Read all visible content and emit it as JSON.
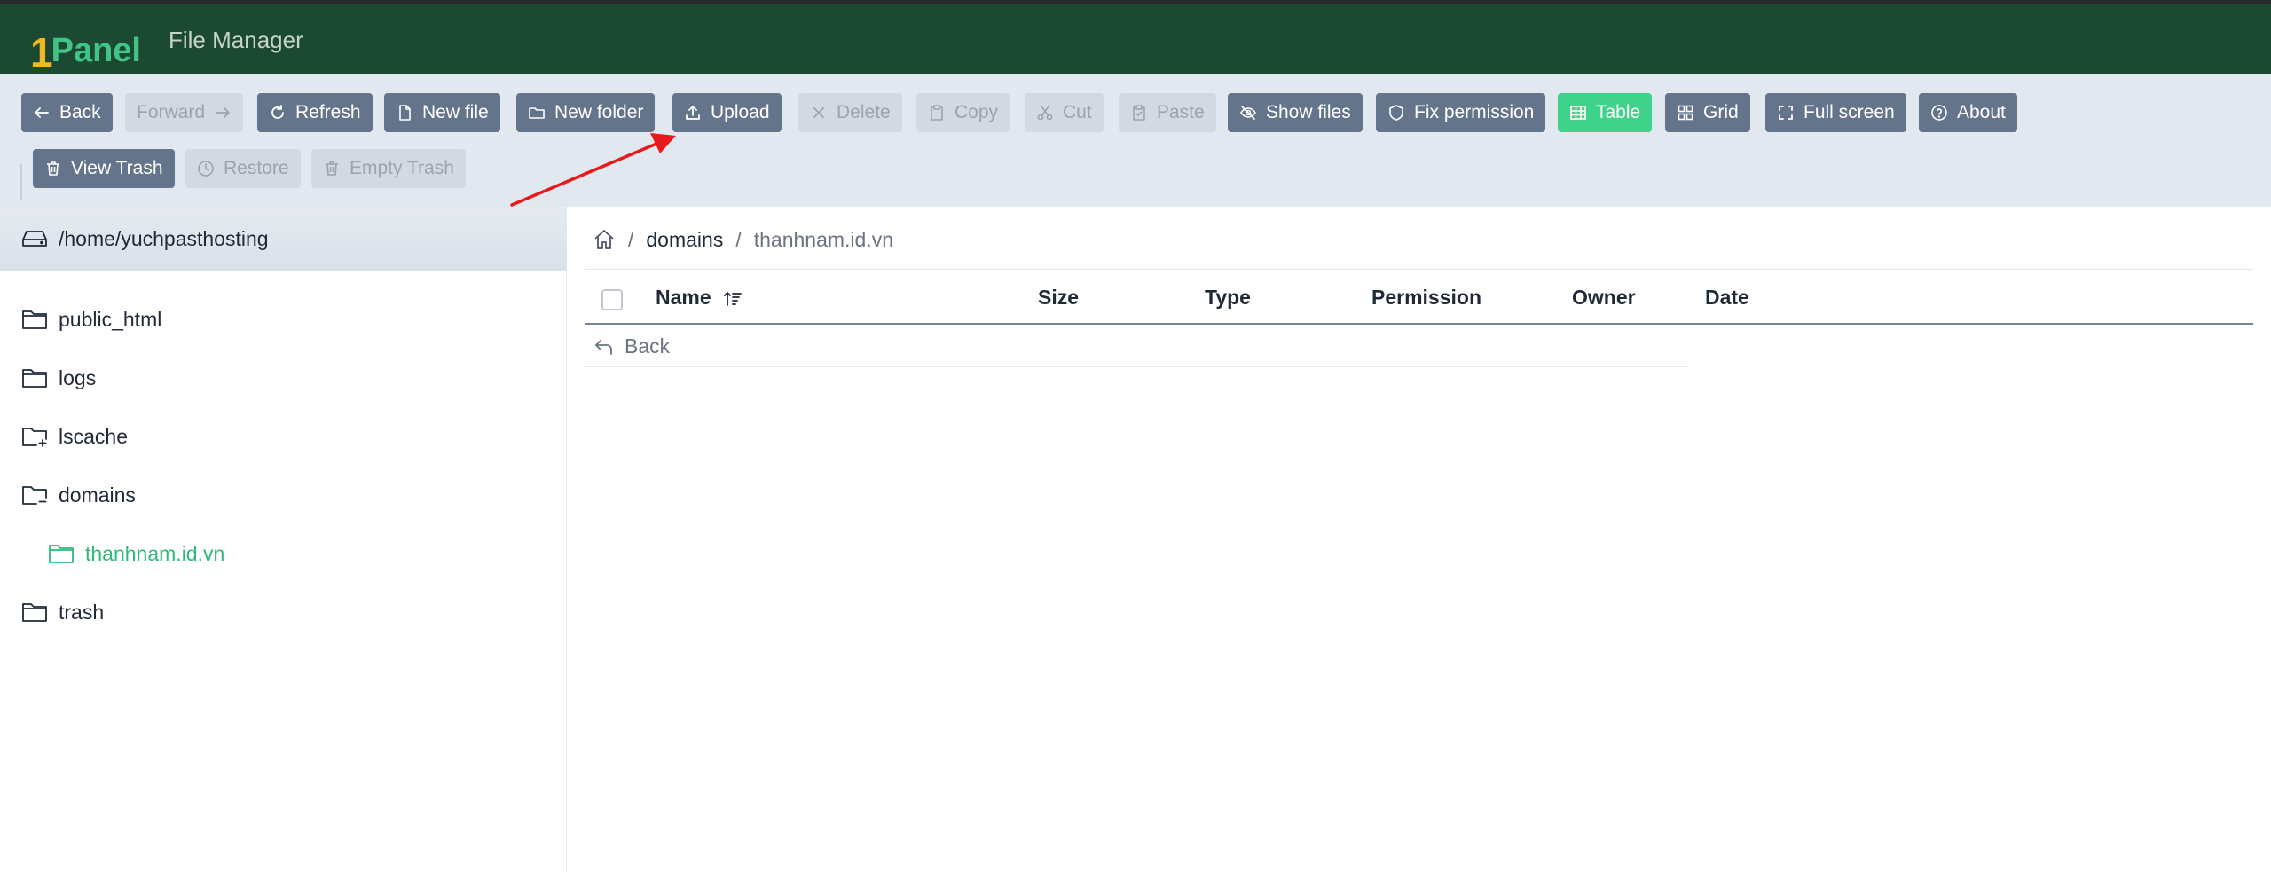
{
  "header": {
    "logo_one": "1",
    "logo_panel": "Panel",
    "title": "File Manager",
    "background": "#1b4932"
  },
  "toolbar": {
    "back": "Back",
    "forward": "Forward",
    "refresh": "Refresh",
    "new_file": "New file",
    "new_folder": "New folder",
    "upload": "Upload",
    "delete": "Delete",
    "copy": "Copy",
    "cut": "Cut",
    "paste": "Paste",
    "show_files": "Show files",
    "fix_permission": "Fix permission",
    "table": "Table",
    "grid": "Grid",
    "full_screen": "Full screen",
    "about": "About",
    "view_trash": "View Trash",
    "restore": "Restore",
    "empty_trash": "Empty Trash"
  },
  "tree": {
    "root": "/home/yuchpasthosting",
    "items": [
      {
        "label": "public_html",
        "icon": "folder-icon"
      },
      {
        "label": "logs",
        "icon": "folder-icon"
      },
      {
        "label": "lscache",
        "icon": "folder-plus-icon"
      },
      {
        "label": "domains",
        "icon": "folder-minus-icon"
      },
      {
        "label": "thanhnam.id.vn",
        "icon": "folder-open-icon",
        "active": true
      },
      {
        "label": "trash",
        "icon": "folder-icon"
      }
    ]
  },
  "breadcrumb": {
    "separator": "/",
    "items": [
      "domains",
      "thanhnam.id.vn"
    ]
  },
  "table": {
    "columns": [
      "Name",
      "Size",
      "Type",
      "Permission",
      "Owner",
      "Date"
    ],
    "back_row": "Back"
  },
  "colors": {
    "accent": "#3fd28b",
    "button_dark": "#64748b",
    "button_disabled": "#d3d9e1",
    "toolbar_bg": "#e2e8f0",
    "annotation_arrow": "#e8191a"
  }
}
